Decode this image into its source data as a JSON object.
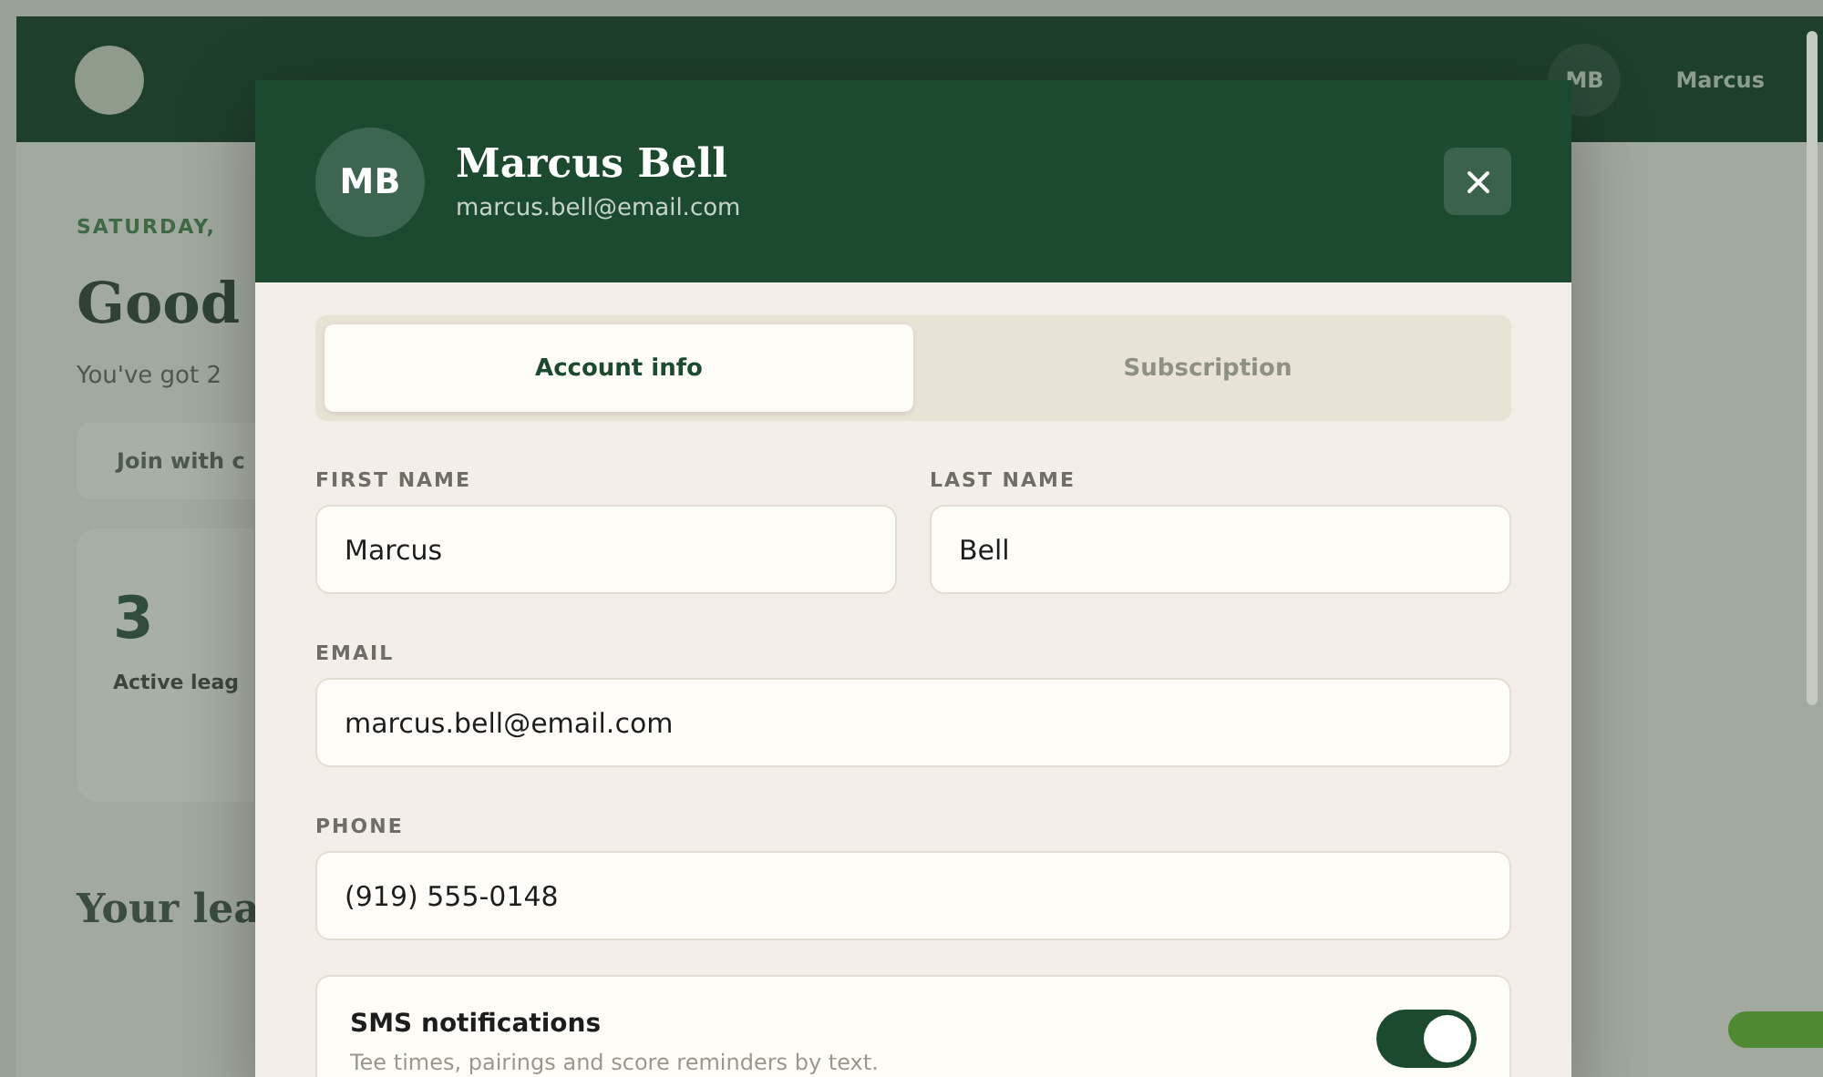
{
  "background": {
    "user": {
      "initials": "MB",
      "name": "Marcus"
    },
    "date": "SATURDAY,",
    "greeting": "Good",
    "subtitle": "You've got 2",
    "join_button": "Join with c",
    "stat": {
      "value": "3",
      "label": "Active leag"
    },
    "section_title": "Your lea"
  },
  "dialog": {
    "initials": "MB",
    "name": "Marcus Bell",
    "email": "marcus.bell@email.com",
    "tabs": [
      {
        "label": "Account info",
        "selected": true
      },
      {
        "label": "Subscription",
        "selected": false
      }
    ],
    "fields": [
      {
        "label": "FIRST NAME",
        "value": "Marcus",
        "half": true
      },
      {
        "label": "LAST NAME",
        "value": "Bell",
        "half": true
      },
      {
        "label": "EMAIL",
        "value": "marcus.bell@email.com",
        "half": false
      },
      {
        "label": "PHONE",
        "value": "(919) 555-0148",
        "half": false
      }
    ],
    "sms": {
      "title": "SMS notifications",
      "description": "Tee times, pairings and score reminders by text.",
      "on": true
    }
  }
}
